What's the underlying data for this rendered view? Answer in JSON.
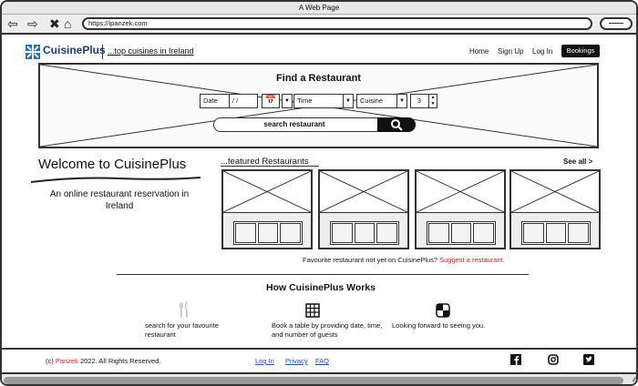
{
  "window": {
    "title": "A Web Page"
  },
  "browser": {
    "url": "https://ipanzek.com",
    "back_icon": "arrow-left-icon",
    "forward_icon": "arrow-right-icon",
    "stop_icon": "close-icon",
    "home_icon": "home-icon"
  },
  "header": {
    "brand": "CuisinePlus",
    "tagline": "...top cuisines in Ireland",
    "nav": {
      "home": "Home",
      "signup": "Sign Up",
      "login": "Log In",
      "bookings": "Bookings"
    }
  },
  "hero": {
    "title": "Find a Restaurant",
    "date_label": "Date",
    "date_value": "/ /",
    "time_label": "Time",
    "cuisine_label": "Cuisine",
    "guests_value": "3",
    "search_placeholder": "search restaurant"
  },
  "welcome": {
    "title": "Welcome to CuisinePlus",
    "subtitle": "An online restaurant reservation in Ireland"
  },
  "featured": {
    "title": "...featured Restaurants",
    "see_all": "See all >",
    "card_count": 4
  },
  "suggest": {
    "text": "Favourite restaurant not yet on CuisinePlus?",
    "link": "Suggest a restaurant."
  },
  "how": {
    "title": "How CuisinePlus Works",
    "steps": [
      {
        "icon": "cutlery-icon",
        "text": "search for your favourite restaurant"
      },
      {
        "icon": "table-grid-icon",
        "text": "Book a table by providing date, time, and number of guests"
      },
      {
        "icon": "checkered-icon",
        "text": "Looking forward to seeing you."
      }
    ]
  },
  "footer": {
    "copyright_prefix": "(c)",
    "company": "Panzek",
    "copyright_suffix": "2022. All Rights Reserved.",
    "links": {
      "login": "Log In",
      "privacy": "Privacy",
      "faq": "FAQ"
    },
    "social": [
      "facebook-icon",
      "instagram-icon",
      "twitter-icon"
    ]
  },
  "colors": {
    "brand": "#1a3f73",
    "accent": "#d32020",
    "link": "#1e4f9c"
  }
}
